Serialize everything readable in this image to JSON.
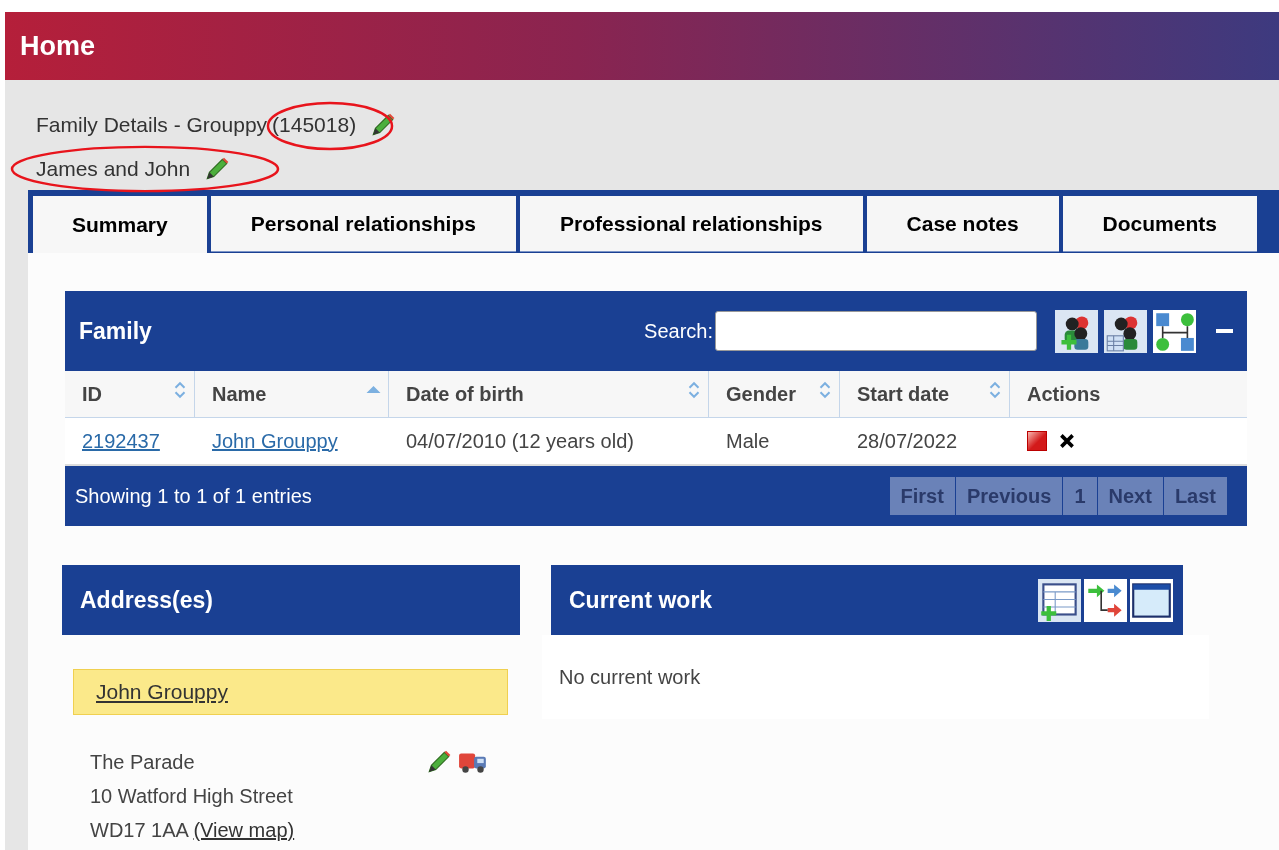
{
  "header": {
    "title": "Home"
  },
  "page_title": {
    "text": "Family Details - Grouppy",
    "id": "(145018)",
    "id_circled": true
  },
  "family_name": {
    "text": "James and John",
    "circled": true
  },
  "tabs": [
    {
      "label": "Summary",
      "selected": true
    },
    {
      "label": "Personal relationships",
      "selected": false
    },
    {
      "label": "Professional relationships",
      "selected": false
    },
    {
      "label": "Case notes",
      "selected": false
    },
    {
      "label": "Documents",
      "selected": false
    }
  ],
  "family_panel": {
    "title": "Family",
    "search_label": "Search:",
    "columns": [
      {
        "label": "ID",
        "sortable": true,
        "sorted_ascending": false
      },
      {
        "label": "Name",
        "sortable": true,
        "sorted_ascending": true
      },
      {
        "label": "Date of birth",
        "sortable": true,
        "sorted_ascending": false
      },
      {
        "label": "Gender",
        "sortable": true,
        "sorted_ascending": false
      },
      {
        "label": "Start date",
        "sortable": true,
        "sorted_ascending": false
      },
      {
        "label": "Actions",
        "sortable": false
      }
    ],
    "rows": [
      {
        "id": "2192437",
        "name": "John Grouppy",
        "dob": "04/07/2010 (12 years old)",
        "gender": "Male",
        "start_date": "28/07/2022"
      }
    ],
    "info": "Showing 1 to 1 of 1 entries",
    "pagination": [
      {
        "label": "First",
        "disabled": true
      },
      {
        "label": "Previous",
        "disabled": true
      },
      {
        "label": "1",
        "disabled": true
      },
      {
        "label": "Next",
        "disabled": true
      },
      {
        "label": "Last",
        "disabled": true
      }
    ]
  },
  "address_panel": {
    "title": "Address(es)",
    "person": "John Grouppy",
    "lines": [
      "The Parade",
      "10 Watford High Street"
    ],
    "postcode": "WD17 1AA",
    "map_link": "(View map)"
  },
  "work_panel": {
    "title": "Current work",
    "empty_text": "No current work"
  }
}
